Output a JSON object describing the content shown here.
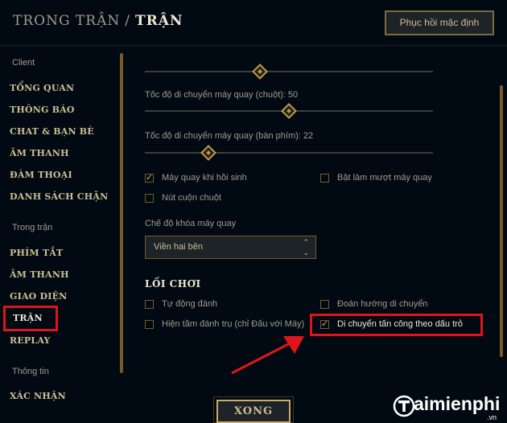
{
  "header": {
    "crumb": "TRONG TRẬN",
    "separator": "/",
    "current": "TRẬN",
    "restore_label": "Phục hồi mặc định"
  },
  "sidebar": {
    "section_client": "Client",
    "client_items": [
      "TỔNG QUAN",
      "THÔNG BÁO",
      "CHAT & BẠN BÈ",
      "ÂM THANH",
      "ĐÀM THOẠI",
      "DANH SÁCH CHẶN"
    ],
    "section_ingame": "Trong trận",
    "ingame_items": [
      "PHÍM TẮT",
      "ÂM THANH",
      "GIAO DIỆN",
      "TRẬN",
      "REPLAY"
    ],
    "section_info": "Thông tin",
    "info_items": [
      "XÁC NHẬN"
    ]
  },
  "camera": {
    "slider_mouse_label": "Tốc độ di chuyển máy quay (chuột): 50",
    "slider_keyboard_label": "Tốc độ di chuyển máy quay (bàn phím): 22",
    "slider_top_value_fraction": 0.4,
    "slider_mouse_fraction": 0.5,
    "slider_keyboard_fraction": 0.22,
    "checks": [
      {
        "label": "Máy quay khi hồi sinh",
        "checked": true
      },
      {
        "label": "Bật làm mượt máy quay",
        "checked": false
      },
      {
        "label": "Nút cuộn chuột",
        "checked": false
      }
    ],
    "lock_mode_label": "Chế độ khóa máy quay",
    "lock_mode_value": "Viền hai bên"
  },
  "gameplay": {
    "heading": "LỐI CHƠI",
    "checks": [
      {
        "label": "Tự động đánh",
        "checked": false
      },
      {
        "label": "Đoán hướng di chuyển",
        "checked": false
      },
      {
        "label": "Hiện tầm đánh trụ (chỉ Đấu với Máy)",
        "checked": false
      },
      {
        "label": "Di chuyển tấn công theo dấu trỏ",
        "checked": true
      }
    ]
  },
  "footer": {
    "done_label": "XONG"
  },
  "watermark": {
    "brand": "aimienphi",
    "tld": ".vn"
  },
  "colors": {
    "background": "#010a13",
    "gold": "#c8aa6e",
    "highlight": "#e0151b"
  }
}
